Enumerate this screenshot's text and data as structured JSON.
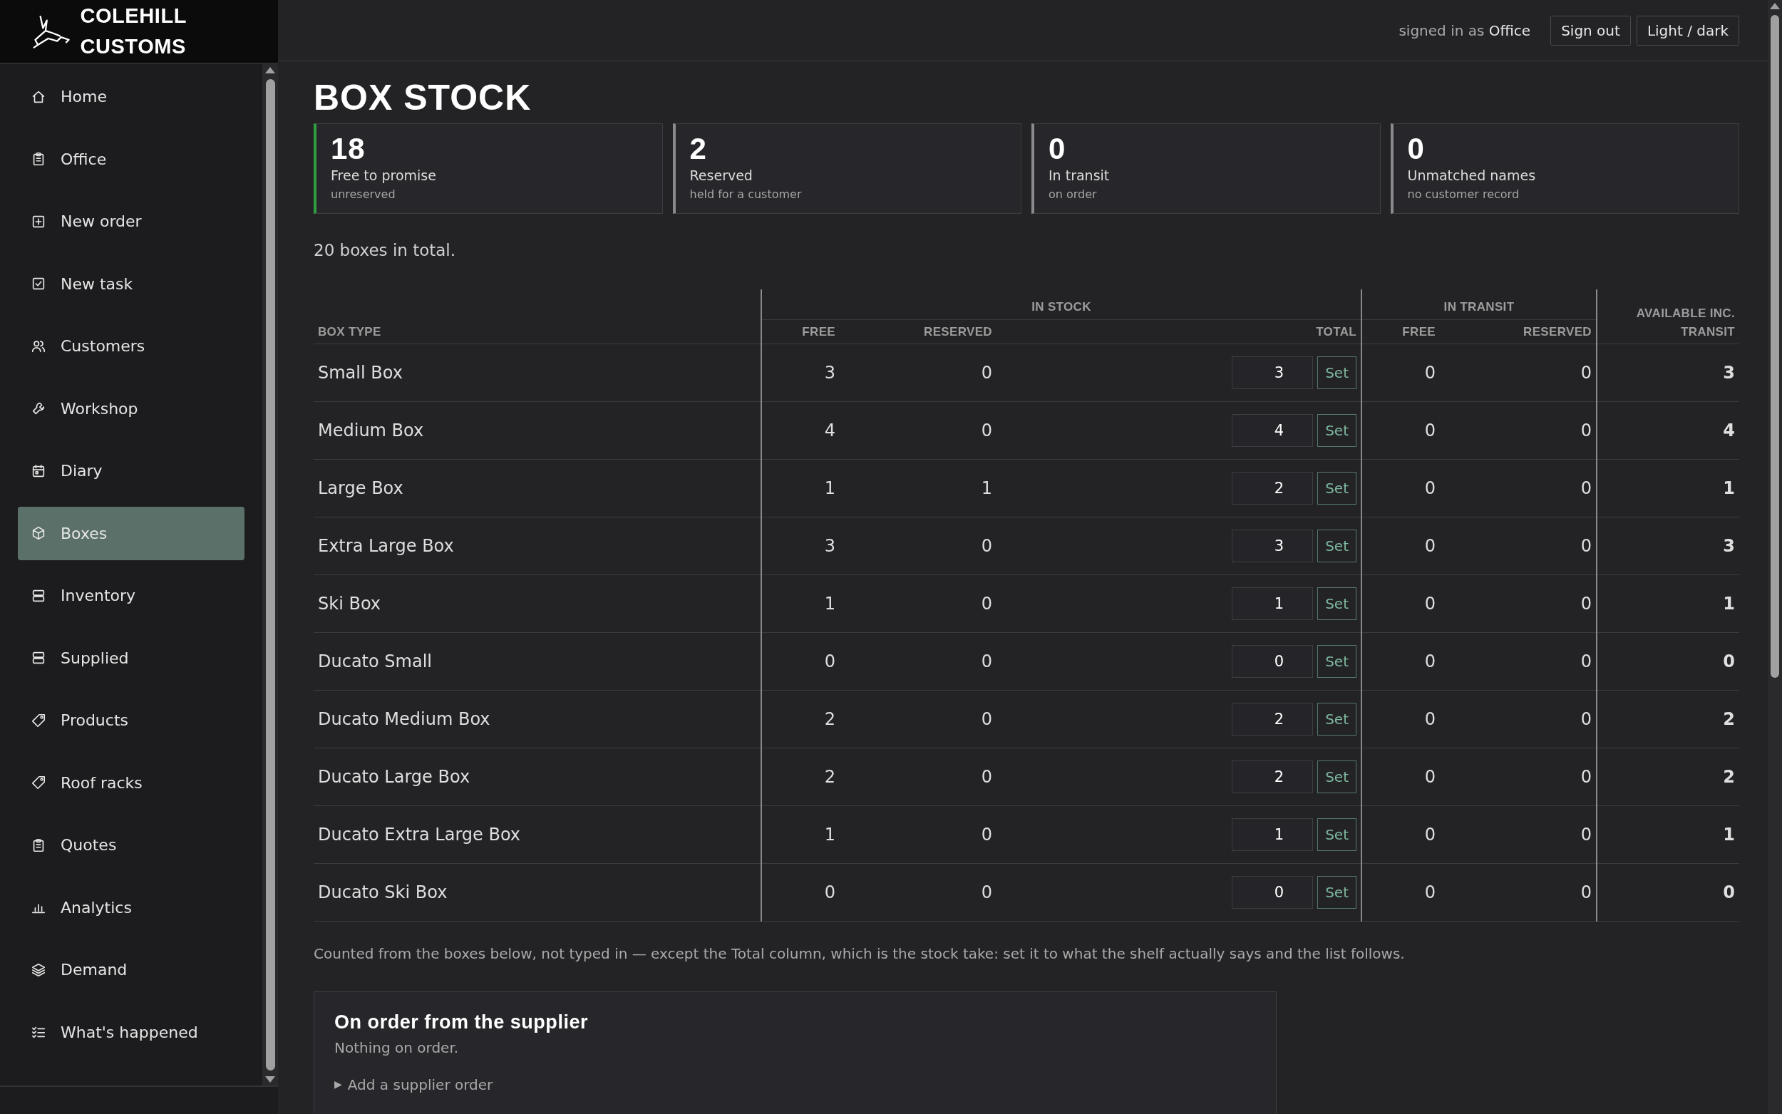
{
  "brand": {
    "name": "COLEHILL CUSTOMS"
  },
  "sidebar": {
    "items": [
      {
        "label": "Home",
        "selected": false
      },
      {
        "label": "Office",
        "selected": false
      },
      {
        "label": "New order",
        "selected": false
      },
      {
        "label": "New task",
        "selected": false
      },
      {
        "label": "Customers",
        "selected": false
      },
      {
        "label": "Workshop",
        "selected": false
      },
      {
        "label": "Diary",
        "selected": false
      },
      {
        "label": "Boxes",
        "selected": true
      },
      {
        "label": "Inventory",
        "selected": false
      },
      {
        "label": "Supplied",
        "selected": false
      },
      {
        "label": "Products",
        "selected": false
      },
      {
        "label": "Roof racks",
        "selected": false
      },
      {
        "label": "Quotes",
        "selected": false
      },
      {
        "label": "Analytics",
        "selected": false
      },
      {
        "label": "Demand",
        "selected": false
      },
      {
        "label": "What's happened",
        "selected": false
      }
    ]
  },
  "header": {
    "signed_in_label": "signed in as",
    "user": "Office",
    "buttons": [
      "Sign out",
      "Light / dark"
    ]
  },
  "page": {
    "title": "BOX STOCK"
  },
  "stats": [
    {
      "value": "18",
      "label": "Free to promise",
      "note": "unreserved",
      "color": "#2e9e3e"
    },
    {
      "value": "2",
      "label": "Reserved",
      "note": "held for a customer",
      "color": "#8a8a8c"
    },
    {
      "value": "0",
      "label": "In transit",
      "note": "on order",
      "color": "#8a8a8c"
    },
    {
      "value": "0",
      "label": "Unmatched names",
      "note": "no customer record",
      "color": "#8a8a8c"
    }
  ],
  "summary": "20 boxes in total.",
  "table": {
    "groups": [
      "IN STOCK",
      "IN TRANSIT"
    ],
    "columns": [
      "BOX TYPE",
      "FREE",
      "RESERVED",
      "TOTAL",
      "FREE",
      "RESERVED",
      "AVAILABLE INC. TRANSIT"
    ],
    "rows": [
      {
        "name": "Small Box",
        "free": "3",
        "reserved": "0",
        "total": "3",
        "action": "Set",
        "transit_free": "0",
        "transit_reserved": "0",
        "available": "3"
      },
      {
        "name": "Medium Box",
        "free": "4",
        "reserved": "0",
        "total": "4",
        "action": "Set",
        "transit_free": "0",
        "transit_reserved": "0",
        "available": "4"
      },
      {
        "name": "Large Box",
        "free": "1",
        "reserved": "1",
        "total": "2",
        "action": "Set",
        "transit_free": "0",
        "transit_reserved": "0",
        "available": "1"
      },
      {
        "name": "Extra Large Box",
        "free": "3",
        "reserved": "0",
        "total": "3",
        "action": "Set",
        "transit_free": "0",
        "transit_reserved": "0",
        "available": "3"
      },
      {
        "name": "Ski Box",
        "free": "1",
        "reserved": "0",
        "total": "1",
        "action": "Set",
        "transit_free": "0",
        "transit_reserved": "0",
        "available": "1"
      },
      {
        "name": "Ducato Small",
        "free": "0",
        "reserved": "0",
        "total": "0",
        "action": "Set",
        "transit_free": "0",
        "transit_reserved": "0",
        "available": "0"
      },
      {
        "name": "Ducato Medium Box",
        "free": "2",
        "reserved": "0",
        "total": "2",
        "action": "Set",
        "transit_free": "0",
        "transit_reserved": "0",
        "available": "2"
      },
      {
        "name": "Ducato Large Box",
        "free": "2",
        "reserved": "0",
        "total": "2",
        "action": "Set",
        "transit_free": "0",
        "transit_reserved": "0",
        "available": "2"
      },
      {
        "name": "Ducato Extra Large Box",
        "free": "1",
        "reserved": "0",
        "total": "1",
        "action": "Set",
        "transit_free": "0",
        "transit_reserved": "0",
        "available": "1"
      },
      {
        "name": "Ducato Ski Box",
        "free": "0",
        "reserved": "0",
        "total": "0",
        "action": "Set",
        "transit_free": "0",
        "transit_reserved": "0",
        "available": "0"
      }
    ]
  },
  "footnote": "Counted from the boxes below, not typed in — except the Total column, which is the stock take: set it to what the shelf actually says and the list follows.",
  "supplier": {
    "title": "On order from the supplier",
    "status": "Nothing on order.",
    "add_label": "Add a supplier order",
    "add_marker": "▶"
  }
}
